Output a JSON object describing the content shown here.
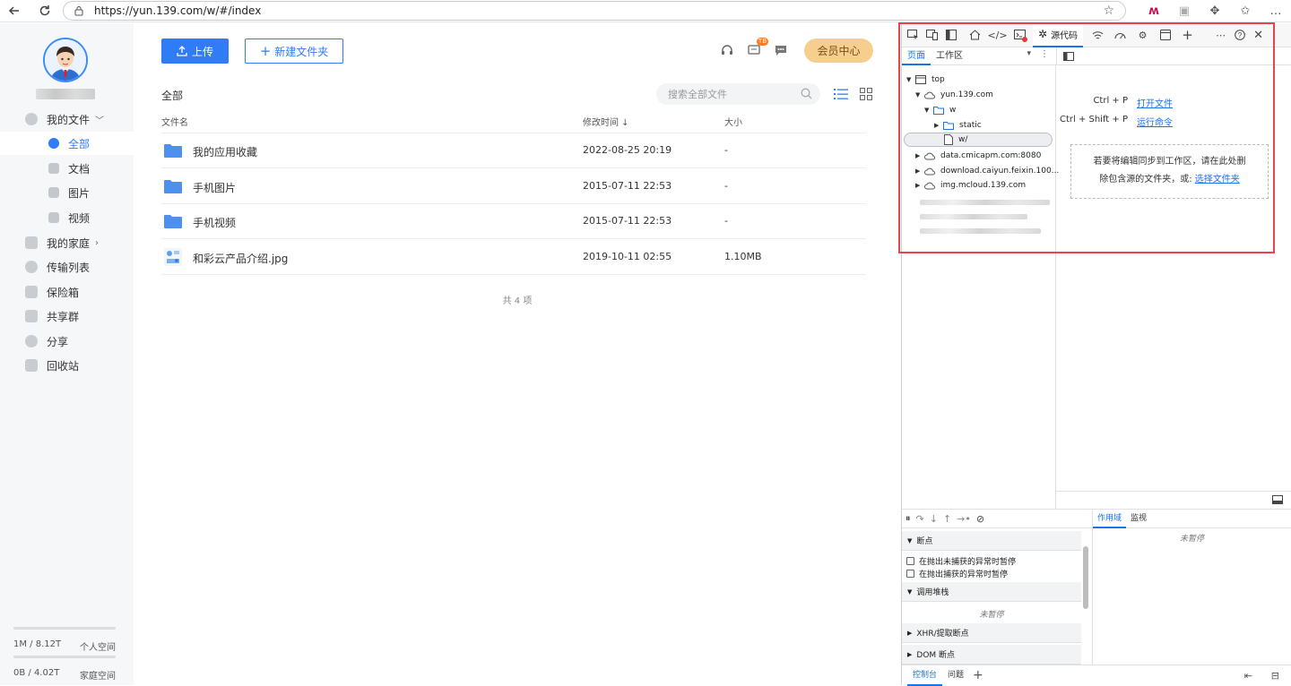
{
  "browser": {
    "url": "https://yun.139.com/w/#/index"
  },
  "sidebar": {
    "nav": [
      {
        "label": "我的文件",
        "expandable": true
      },
      {
        "label": "全部",
        "active": true
      },
      {
        "label": "文档"
      },
      {
        "label": "图片"
      },
      {
        "label": "视频"
      },
      {
        "label": "我的家庭",
        "expandable": true
      },
      {
        "label": "传输列表"
      },
      {
        "label": "保险箱"
      },
      {
        "label": "共享群"
      },
      {
        "label": "分享"
      },
      {
        "label": "回收站"
      }
    ],
    "storage": [
      {
        "used": "1M / 8.12T",
        "label": "个人空间"
      },
      {
        "used": "0B / 4.02T",
        "label": "家庭空间"
      }
    ]
  },
  "toolbar": {
    "upload_label": "上传",
    "new_folder_label": "新建文件夹",
    "badge": "TB",
    "vip_label": "会员中心"
  },
  "files": {
    "breadcrumb": "全部",
    "search_placeholder": "搜索全部文件",
    "columns": {
      "name": "文件名",
      "modified": "修改时间 ↓",
      "size": "大小"
    },
    "rows": [
      {
        "name": "我的应用收藏",
        "date": "2022-08-25  20:19",
        "size": "-",
        "type": "folder"
      },
      {
        "name": "手机图片",
        "date": "2015-07-11  22:53",
        "size": "-",
        "type": "folder"
      },
      {
        "name": "手机视频",
        "date": "2015-07-11  22:53",
        "size": "-",
        "type": "folder"
      },
      {
        "name": "和彩云产品介绍.jpg",
        "date": "2019-10-11  02:55",
        "size": "1.10MB",
        "type": "image"
      }
    ],
    "total": "共 4 项"
  },
  "devtools": {
    "sources_tab": "源代码",
    "subtabs": [
      "页面",
      "工作区"
    ],
    "tree": {
      "top": "top",
      "host": "yun.139.com",
      "w": "w",
      "static": "static",
      "w_file": "w/",
      "data": "data.cmicapm.com:8080",
      "download": "download.caiyun.feixin.100...",
      "img": "img.mcloud.139.com"
    },
    "shortcuts": [
      {
        "key": "Ctrl + P",
        "action": "打开文件"
      },
      {
        "key": "Ctrl + Shift + P",
        "action": "运行命令"
      }
    ],
    "dropzone": {
      "text1": "若要将编辑同步到工作区，请在此处删",
      "text2": "除包含源的文件夹，或:",
      "link": "选择文件夹"
    },
    "scope_tabs": [
      "作用域",
      "监视"
    ],
    "not_paused": "未暂停",
    "breakpoints": {
      "header": "断点",
      "options": [
        "在抛出未捕获的异常时暂停",
        "在抛出捕获的异常时暂停"
      ]
    },
    "callstack": {
      "header": "调用堆栈",
      "empty": "未暂停"
    },
    "xhr": "XHR/提取断点",
    "dom": "DOM 断点",
    "drawer_tabs": [
      "控制台",
      "问题"
    ]
  },
  "colors": {
    "primary": "#2f7cf6",
    "vip": "#f6cf8e",
    "highlight": "#e8434c",
    "devtools_accent": "#1a73e8"
  }
}
